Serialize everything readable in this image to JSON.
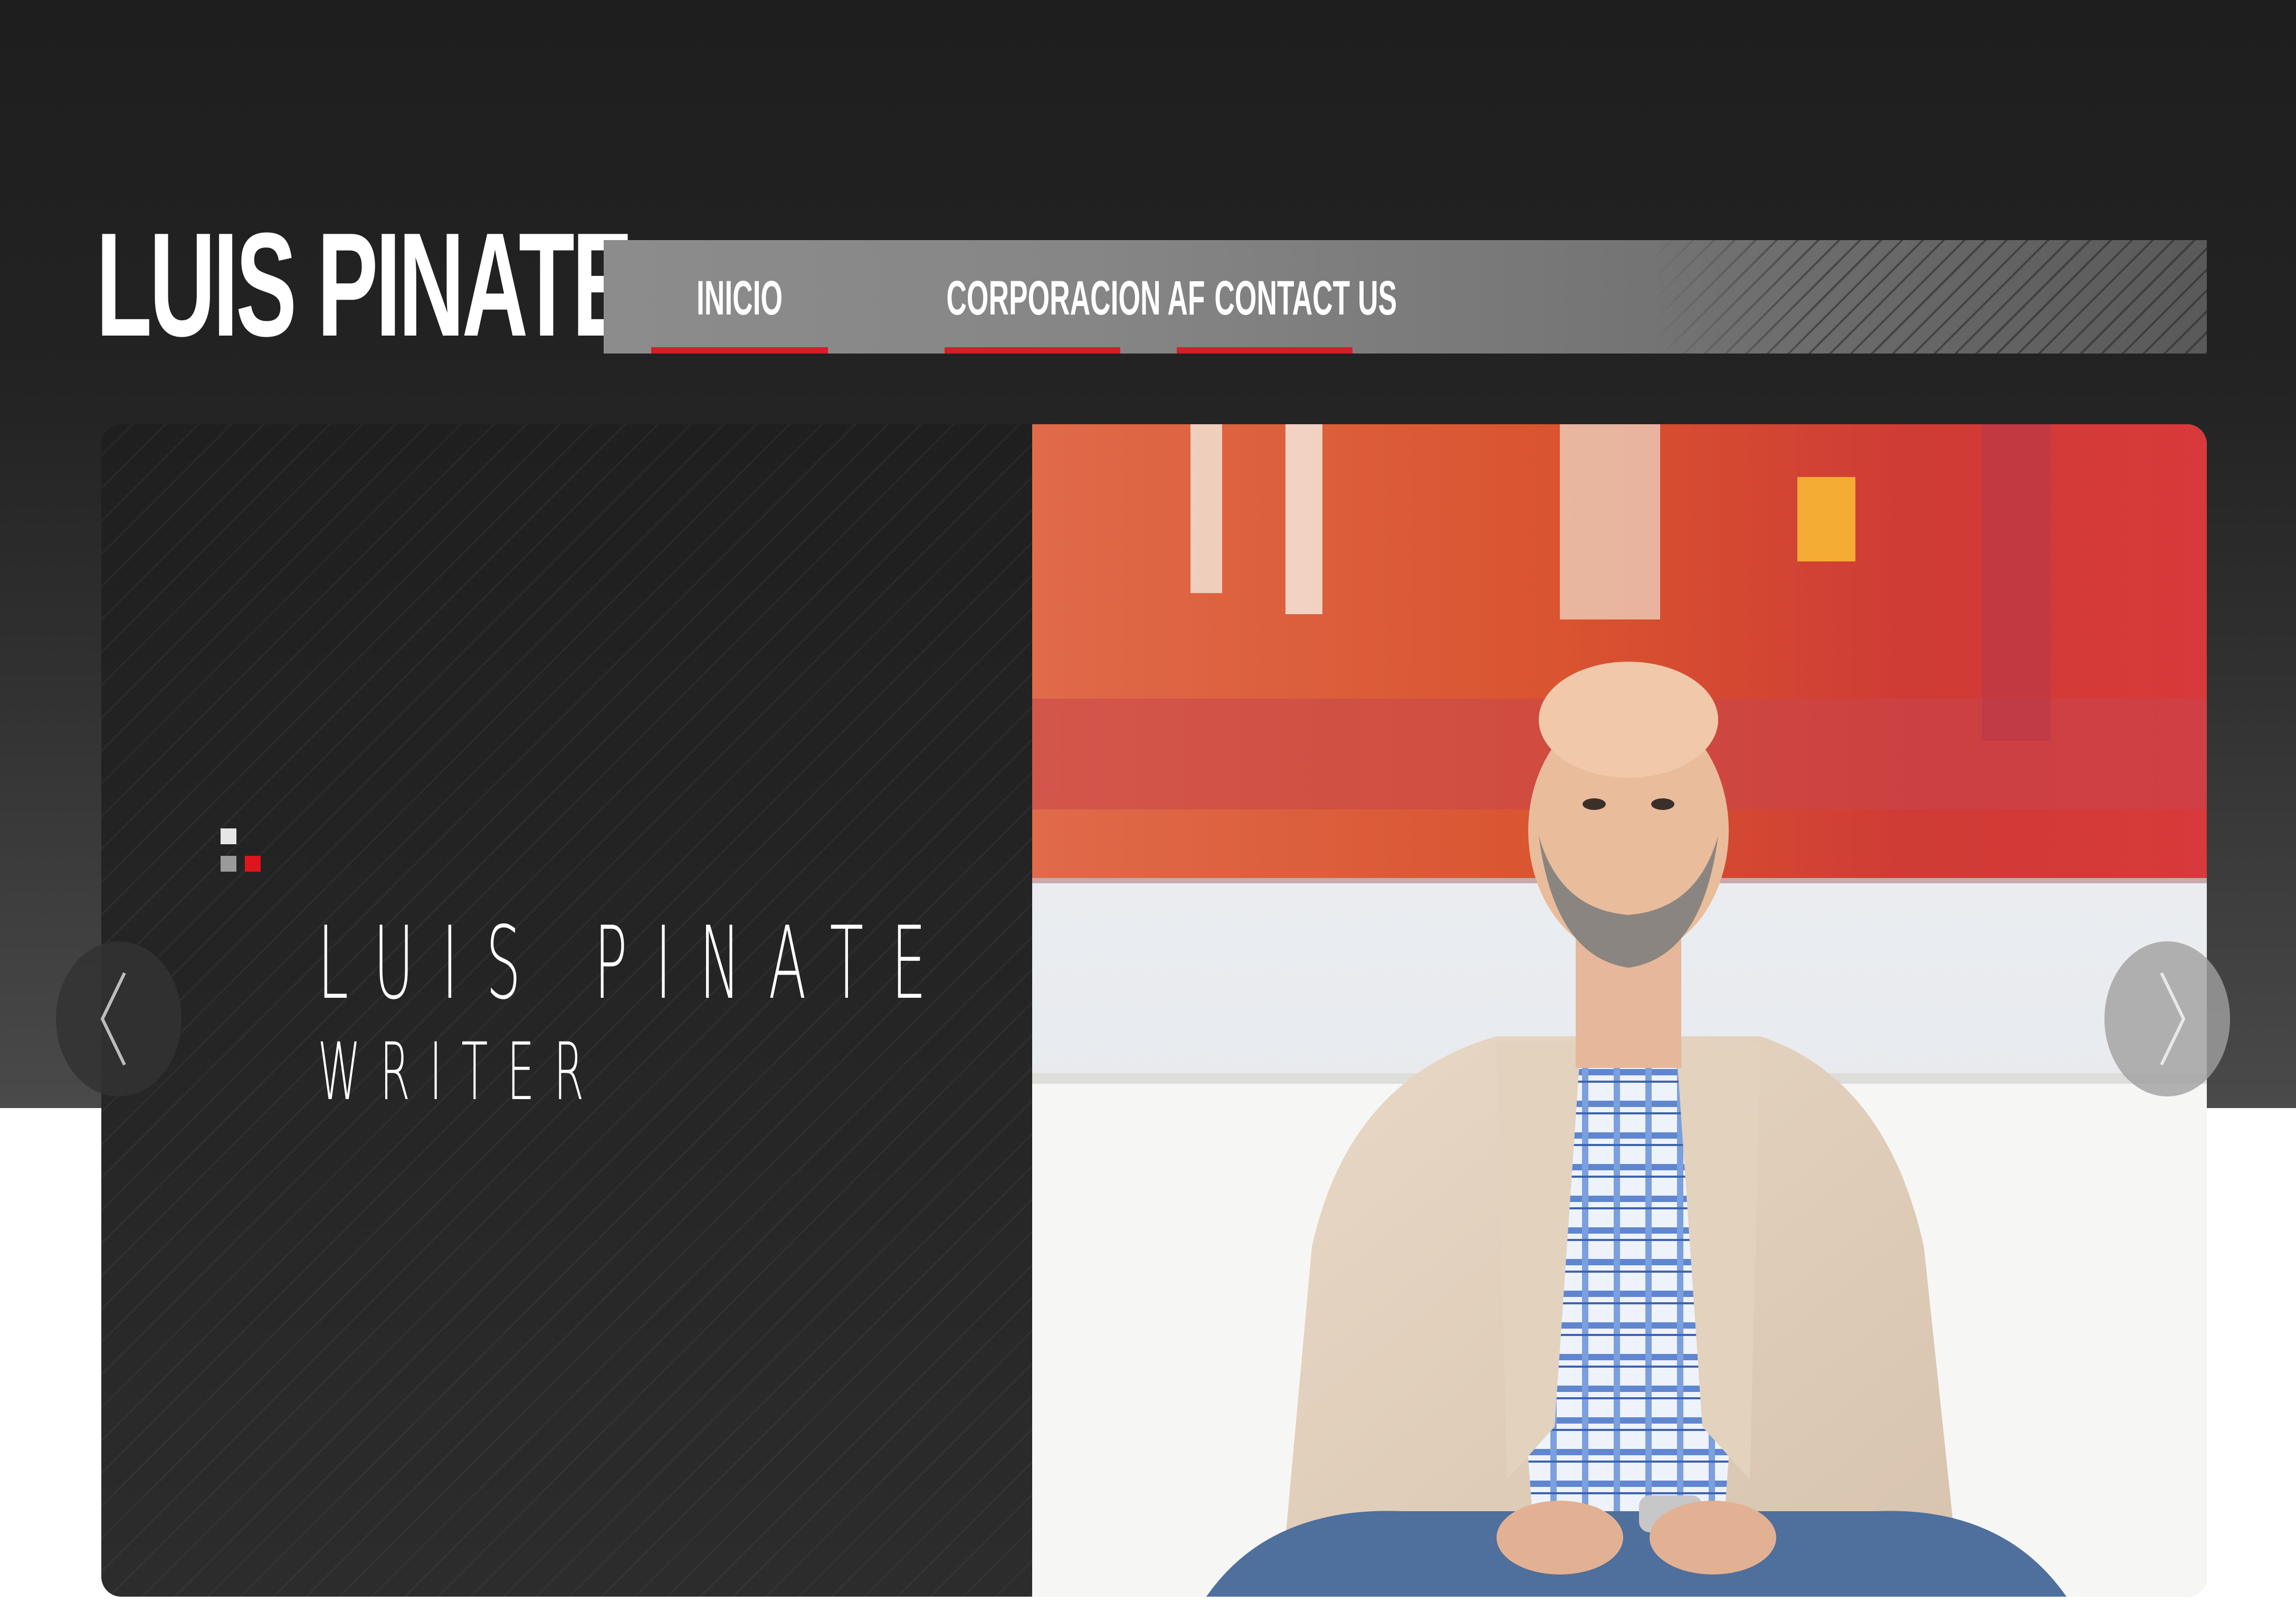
{
  "site": {
    "logo_text": "LUIS PINATE"
  },
  "nav": {
    "items": [
      {
        "label": "INICIO"
      },
      {
        "label": "CORPORACION AF"
      },
      {
        "label": "CONTACT US"
      }
    ]
  },
  "slide": {
    "name": "LUIS PINATE",
    "role": "WRITER"
  },
  "icons": {
    "prev": "chevron-left-icon",
    "next": "chevron-right-icon"
  },
  "colors": {
    "accent": "#d12028",
    "header_background": "#1e1e1e",
    "navbar": "#868686",
    "slide_panel": "#242424"
  }
}
